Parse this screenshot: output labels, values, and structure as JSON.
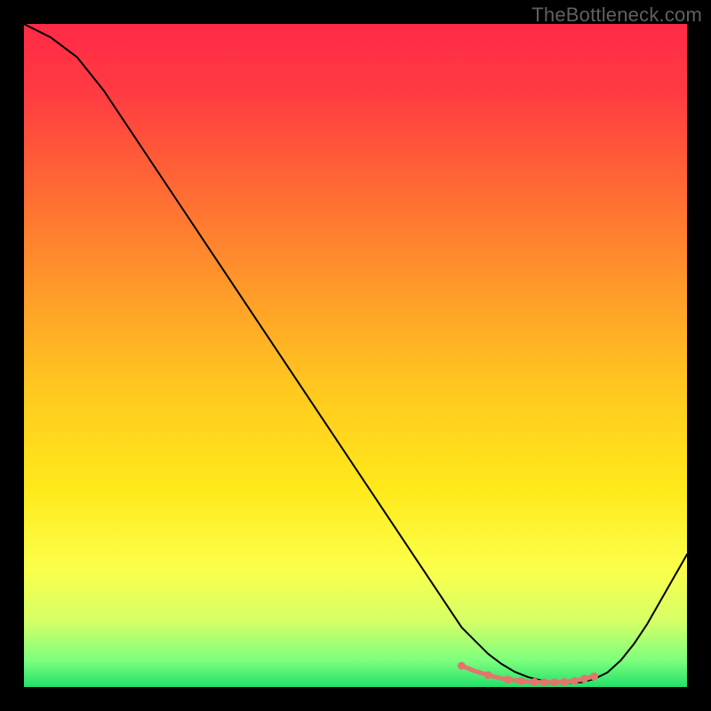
{
  "watermark": "TheBottleneck.com",
  "chart_data": {
    "type": "line",
    "title": "",
    "xlabel": "",
    "ylabel": "",
    "xlim": [
      0,
      100
    ],
    "ylim": [
      0,
      100
    ],
    "background_gradient": {
      "stops": [
        {
          "offset": 0.0,
          "color": "#ff2a47"
        },
        {
          "offset": 0.1,
          "color": "#ff3a42"
        },
        {
          "offset": 0.25,
          "color": "#ff6a34"
        },
        {
          "offset": 0.4,
          "color": "#ff9a2a"
        },
        {
          "offset": 0.55,
          "color": "#ffc81f"
        },
        {
          "offset": 0.7,
          "color": "#ffe91a"
        },
        {
          "offset": 0.82,
          "color": "#fbff4a"
        },
        {
          "offset": 0.9,
          "color": "#d6ff66"
        },
        {
          "offset": 0.96,
          "color": "#7dff7d"
        },
        {
          "offset": 1.0,
          "color": "#22e06a"
        }
      ]
    },
    "series": [
      {
        "name": "curve",
        "color": "#000000",
        "width": 2.0,
        "x": [
          0,
          4,
          8,
          12,
          16,
          20,
          24,
          28,
          32,
          36,
          40,
          44,
          48,
          52,
          56,
          60,
          64,
          66,
          68,
          70,
          72,
          74,
          76,
          78,
          80,
          82,
          84,
          86,
          88,
          90,
          92,
          94,
          96,
          98,
          100
        ],
        "y": [
          100,
          98,
          95,
          90,
          84,
          78,
          72,
          66,
          60,
          54,
          48,
          42,
          36,
          30,
          24,
          18,
          12,
          9,
          7,
          5,
          3.5,
          2.3,
          1.5,
          1,
          0.7,
          0.6,
          0.7,
          1.2,
          2.2,
          4,
          6.5,
          9.5,
          13,
          16.5,
          20
        ]
      },
      {
        "name": "highlight",
        "color": "#e2766d",
        "width": 5.0,
        "x": [
          66,
          68,
          70,
          72,
          74,
          76,
          78,
          80,
          82,
          84,
          86
        ],
        "y": [
          3.2,
          2.4,
          1.8,
          1.3,
          1.0,
          0.8,
          0.7,
          0.7,
          0.8,
          1.1,
          1.6
        ]
      }
    ],
    "markers": {
      "name": "highlight-dots",
      "color": "#e2766d",
      "radius": 4.5,
      "x": [
        66,
        70,
        73,
        75,
        77,
        78.5,
        80,
        81.5,
        83,
        84.5,
        86
      ],
      "y": [
        3.2,
        1.8,
        1.1,
        0.9,
        0.75,
        0.7,
        0.7,
        0.75,
        0.9,
        1.25,
        1.6
      ]
    }
  }
}
